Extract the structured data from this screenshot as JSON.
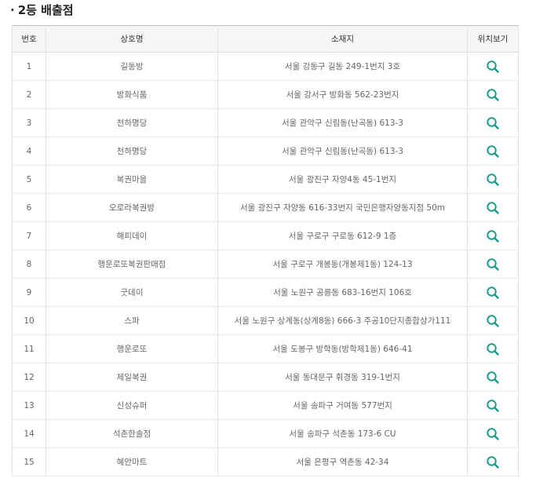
{
  "section": {
    "bullet": "·",
    "title": "2등 배출점"
  },
  "table": {
    "headers": {
      "no": "번호",
      "name": "상호명",
      "address": "소재지",
      "location": "위치보기"
    },
    "rows": [
      {
        "no": "1",
        "name": "길동방",
        "address": "서울 강동구 길동 249-1번지 3호"
      },
      {
        "no": "2",
        "name": "방화식품",
        "address": "서울 강서구 방화동 562-23번지"
      },
      {
        "no": "3",
        "name": "천하명당",
        "address": "서울 관악구 신림동(난곡동) 613-3"
      },
      {
        "no": "4",
        "name": "천하명당",
        "address": "서울 관악구 신림동(난곡동) 613-3"
      },
      {
        "no": "5",
        "name": "복권마을",
        "address": "서울 광진구 자양4동 45-1번지"
      },
      {
        "no": "6",
        "name": "오로라복권방",
        "address": "서울 광진구 자양동 616-33번지 국민은행자양동지점 50m"
      },
      {
        "no": "7",
        "name": "해피데이",
        "address": "서울 구로구 구로동 612-9 1층"
      },
      {
        "no": "8",
        "name": "행운로또복권판매점",
        "address": "서울 구로구 개봉동(개봉제1동) 124-13"
      },
      {
        "no": "9",
        "name": "굿데이",
        "address": "서울 노원구 공릉동 683-16번지 106호"
      },
      {
        "no": "10",
        "name": "스파",
        "address": "서울 노원구 상계동(상계8동) 666-3 주공10단지종합상가111"
      },
      {
        "no": "11",
        "name": "행운로또",
        "address": "서울 도봉구 방학동(방학제1동) 646-41"
      },
      {
        "no": "12",
        "name": "제일복권",
        "address": "서울 동대문구 휘경동 319-1번지"
      },
      {
        "no": "13",
        "name": "신성슈퍼",
        "address": "서울 송파구 거여동 577번지"
      },
      {
        "no": "14",
        "name": "석촌한솔점",
        "address": "서울 송파구 석촌동 173-6 CU"
      },
      {
        "no": "15",
        "name": "혜안마트",
        "address": "서울 은평구 역촌동 42-34"
      }
    ]
  },
  "icons": {
    "location": "search-icon"
  },
  "colors": {
    "icon": "#1a9c8f",
    "header_bg": "#f6f6f6",
    "title": "#222222"
  }
}
